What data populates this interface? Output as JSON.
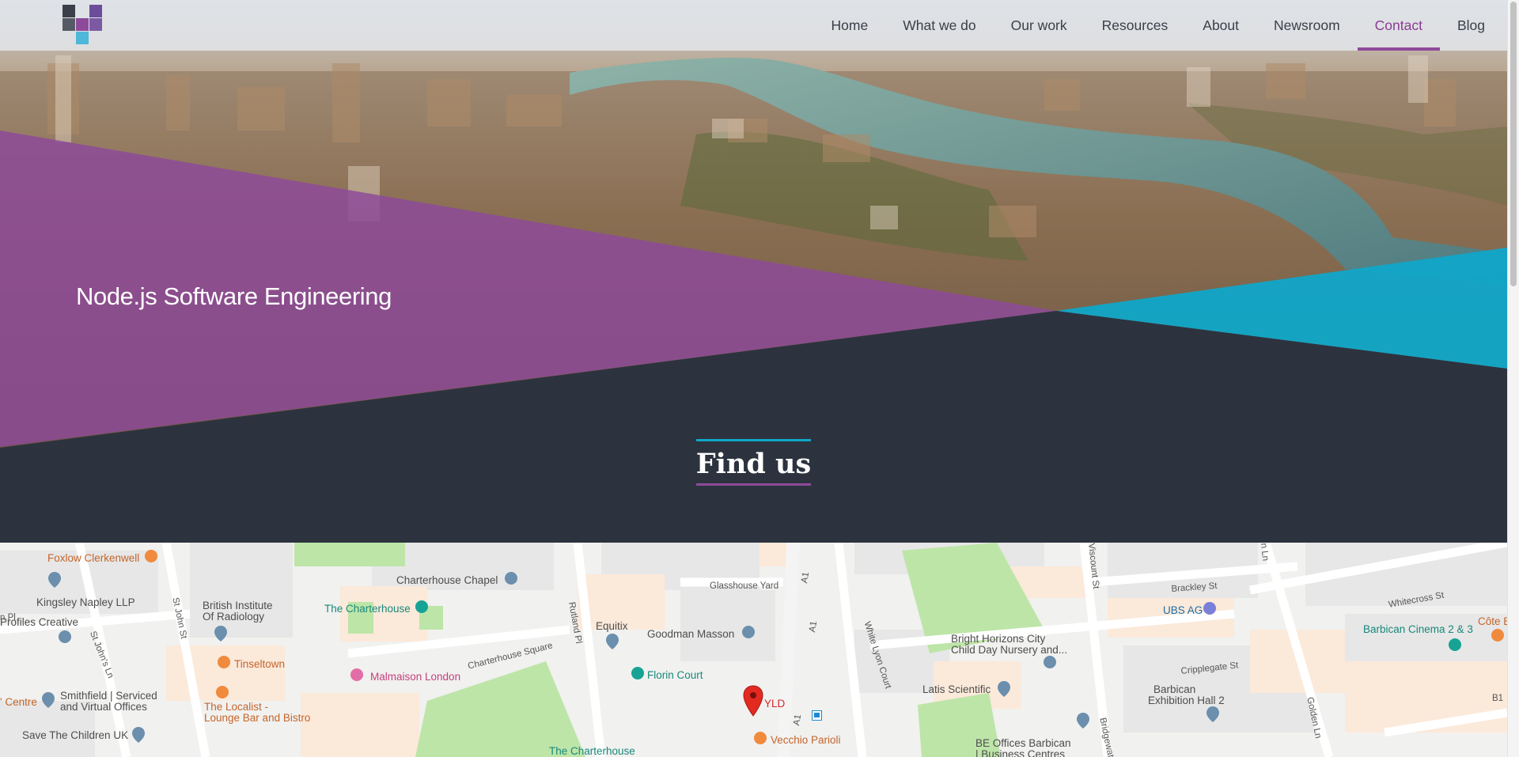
{
  "nav": {
    "items": [
      {
        "label": "Home",
        "active": false
      },
      {
        "label": "What we do",
        "active": false
      },
      {
        "label": "Our work",
        "active": false
      },
      {
        "label": "Resources",
        "active": false
      },
      {
        "label": "About",
        "active": false
      },
      {
        "label": "Newsroom",
        "active": false
      },
      {
        "label": "Contact",
        "active": true
      },
      {
        "label": "Blog",
        "active": false
      }
    ]
  },
  "hero": {
    "title": "Node.js Software Engineering"
  },
  "section": {
    "title": "Find us"
  },
  "map": {
    "places": {
      "foxlow": "Foxlow Clerkenwell",
      "kingsley": "Kingsley Napley LLP",
      "profiles": "Profiles Creative",
      "british_inst_1": "British Institute",
      "british_inst_2": "Of Radiology",
      "charterhouse_chapel": "Charterhouse Chapel",
      "the_charterhouse": "The Charterhouse",
      "the_charterhouse_2": "The Charterhouse",
      "glasshouse": "Glasshouse Yard",
      "equitix": "Equitix",
      "goodman": "Goodman Masson",
      "tinseltown": "Tinseltown",
      "malmaison": "Malmaison London",
      "charterhouse_sq": "Charterhouse Square",
      "florin": "Florin Court",
      "yld": "YLD",
      "vecchio": "Vecchio Parioli",
      "localist_1": "The Localist -",
      "localist_2": "Lounge Bar and Bistro",
      "centre": "' Centre",
      "smithfield_1": "Smithfield | Serviced",
      "smithfield_2": "and Virtual Offices",
      "save_children": "Save The Children UK",
      "bright_1": "Bright Horizons City",
      "bright_2": "Child Day Nursery and...",
      "latis": "Latis Scientific",
      "ubs": "UBS AG",
      "barbican_ex_1": "Barbican",
      "barbican_ex_2": "Exhibition Hall 2",
      "barbican_cinema": "Barbican Cinema 2 & 3",
      "cote": "Côte B",
      "be_offices_1": "BE Offices Barbican",
      "be_offices_2": "| Business Centres"
    },
    "streets": {
      "st_john": "St John St",
      "st_johns_ln": "St John's Ln",
      "rutland": "Rutland Pl",
      "a1_top": "A1",
      "a1_mid": "A1",
      "a1_bottom": "A1",
      "white_lyon": "White Lyon Court",
      "brackley": "Brackley St",
      "viscount": "Viscount St",
      "golden_ln": "Golden Ln",
      "cripplegate": "Cripplegate St",
      "whitecross": "Whitecross St",
      "bridgewater": "Bridgewat",
      "pl_left": "n Pl",
      "ln_top": "n Ln",
      "b1": "B1"
    }
  },
  "colors": {
    "purple": "#8e4a9a",
    "teal": "#10a6c9",
    "dark": "#2c333f",
    "nav_active": "#8a3c92"
  }
}
